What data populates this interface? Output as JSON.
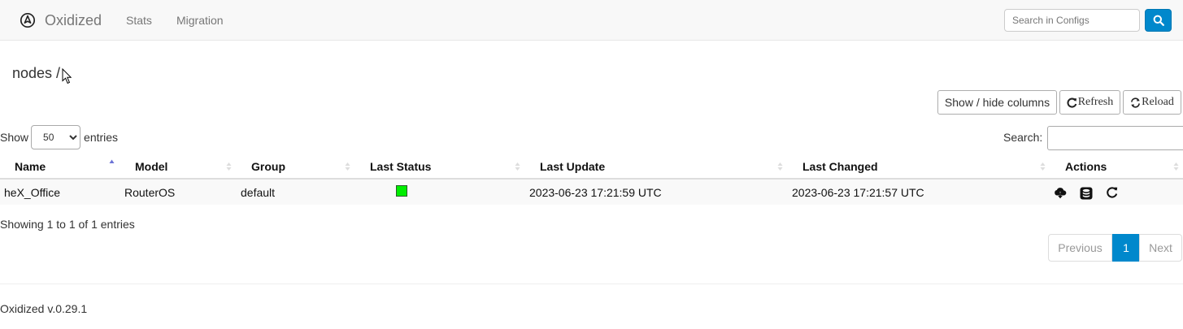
{
  "navbar": {
    "brand": "Oxidized",
    "links": [
      "Stats",
      "Migration"
    ],
    "search_placeholder": "Search in Configs",
    "search_icon": "search-icon"
  },
  "page": {
    "title": "nodes /"
  },
  "toolbar": {
    "columns_label": "Show / hide columns",
    "refresh_label": "Refresh",
    "reload_label": "Reload"
  },
  "table_controls": {
    "show_label": "Show",
    "length_value": "50",
    "entries_label": "entries",
    "search_label": "Search:",
    "search_value": ""
  },
  "table": {
    "columns": [
      "Name",
      "Model",
      "Group",
      "Last Status",
      "Last Update",
      "Last Changed",
      "Actions"
    ],
    "sorted_column": "Name",
    "sort_direction": "ascending",
    "rows": [
      {
        "name": "heX_Office",
        "model": "RouterOS",
        "group": "default",
        "status_color": "#00ee00",
        "last_update": "2023-06-23 17:21:59 UTC",
        "last_changed": "2023-06-23 17:21:57 UTC",
        "actions": [
          "cloud-download-icon",
          "database-icon",
          "refresh-icon"
        ]
      }
    ]
  },
  "info": "Showing 1 to 1 of 1 entries",
  "pagination": {
    "previous": "Previous",
    "current": "1",
    "next": "Next"
  },
  "footer": "Oxidized v.0.29.1",
  "colors": {
    "accent": "#0088cc",
    "status_ok": "#00ee00"
  }
}
